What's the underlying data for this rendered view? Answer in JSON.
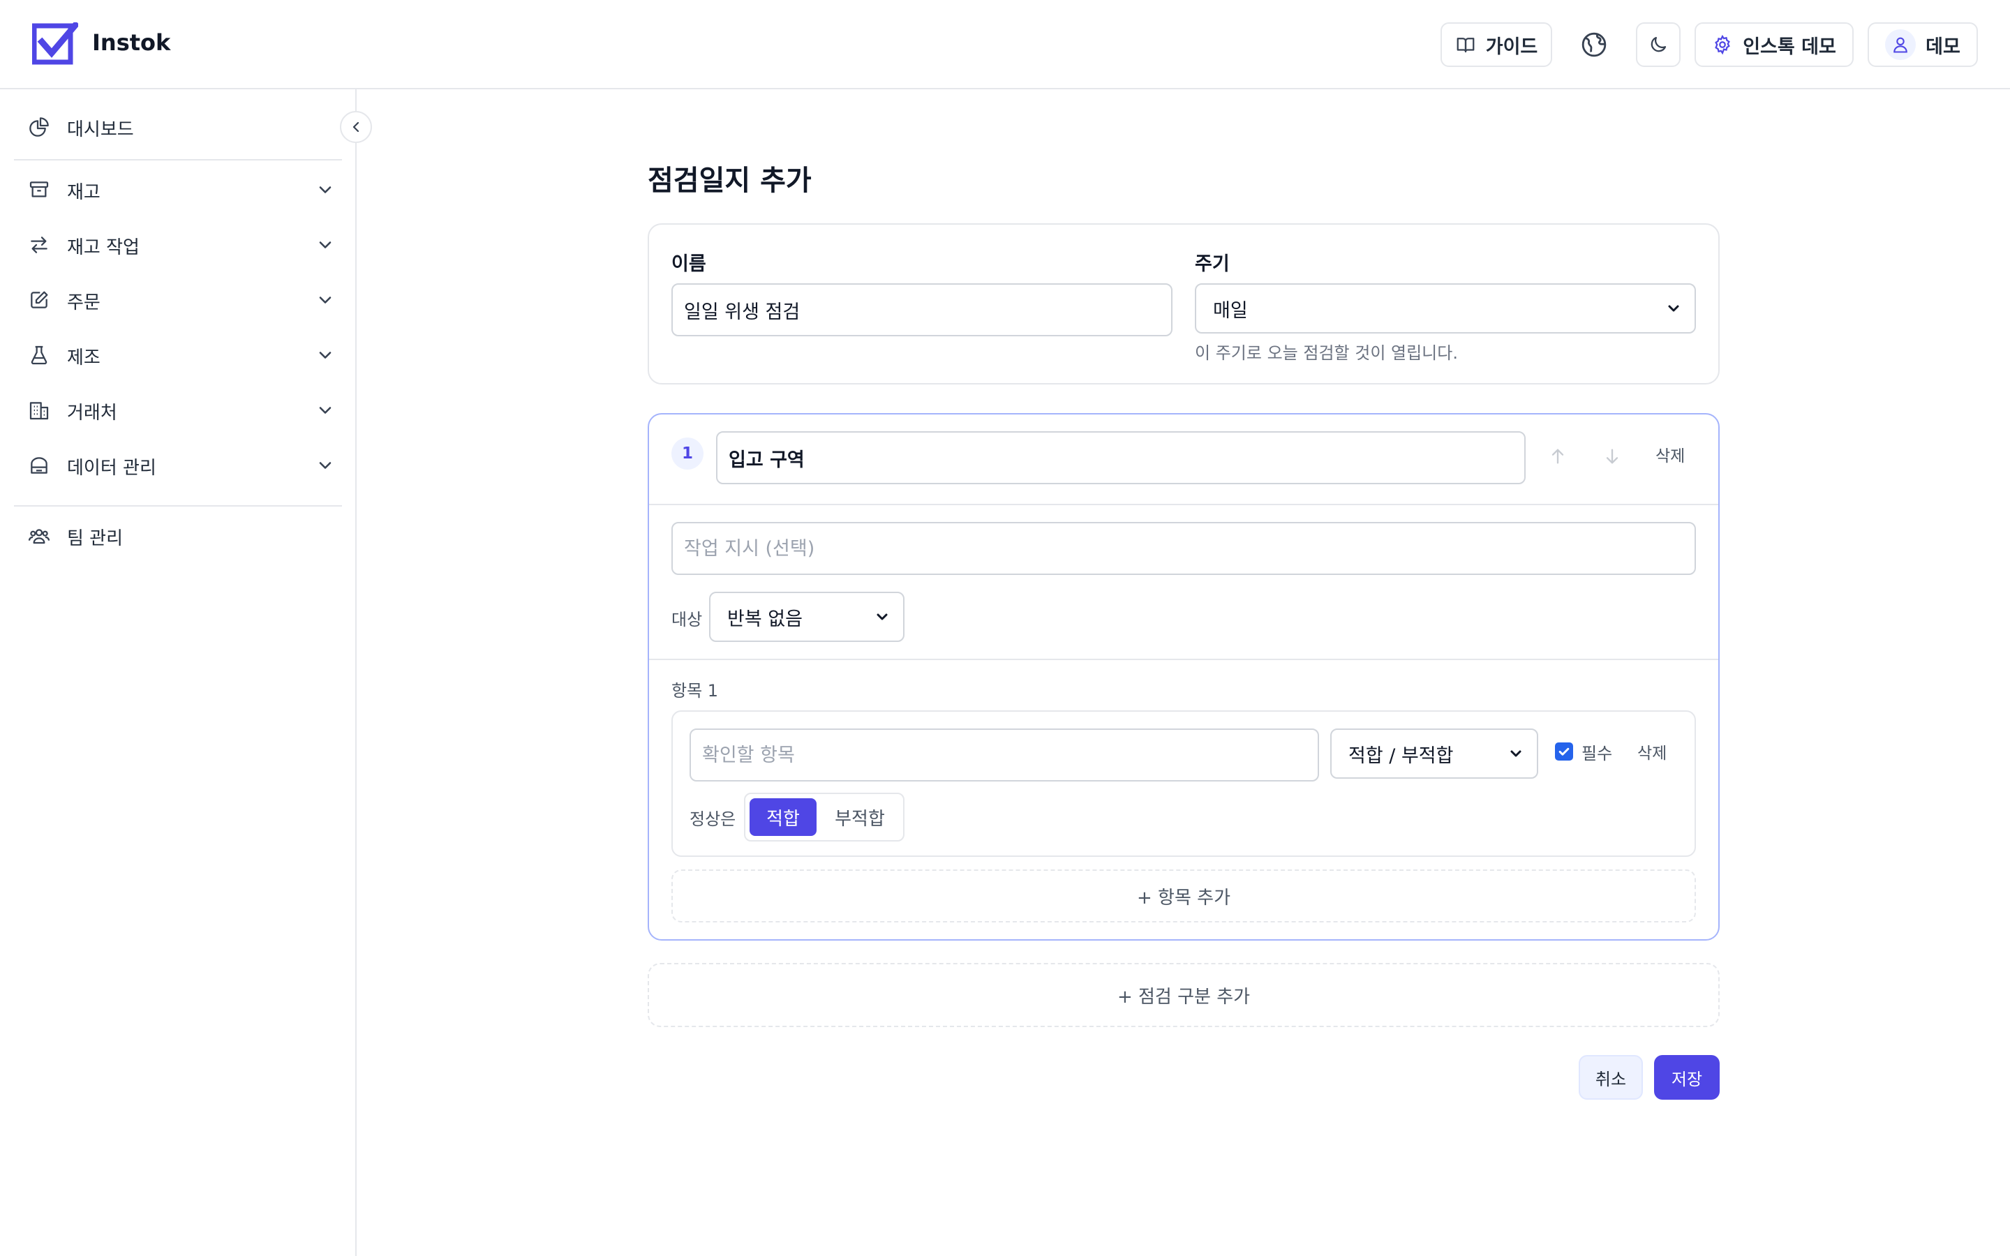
{
  "app": {
    "brand": "Instok"
  },
  "header": {
    "guide_label": "가이드",
    "workspace_label": "인스톡 데모",
    "user_label": "데모"
  },
  "sidebar": {
    "items": [
      {
        "label": "대시보드",
        "icon": "chart-pie-icon"
      },
      {
        "label": "재고",
        "icon": "archive-box-icon"
      },
      {
        "label": "재고 작업",
        "icon": "arrows-swap-icon"
      },
      {
        "label": "주문",
        "icon": "edit-document-icon"
      },
      {
        "label": "제조",
        "icon": "beaker-icon"
      },
      {
        "label": "거래처",
        "icon": "building-icon"
      },
      {
        "label": "데이터 관리",
        "icon": "database-icon"
      },
      {
        "label": "팀 관리",
        "icon": "users-icon"
      }
    ]
  },
  "page": {
    "title": "점검일지 추가"
  },
  "form": {
    "name_label": "이름",
    "name_value": "일일 위생 점검",
    "cycle_label": "주기",
    "cycle_value": "매일",
    "cycle_hint": "이 주기로 오늘 점검할 것이 열립니다."
  },
  "section": {
    "number": "1",
    "title_value": "입고 구역",
    "delete_label": "삭제",
    "instruction_placeholder": "작업 지시 (선택)",
    "target_label": "대상",
    "target_value": "반복 없음",
    "item_heading": "항목 1",
    "item": {
      "placeholder": "확인할 항목",
      "type_value": "적합 / 부적합",
      "required_label": "필수",
      "delete_label": "삭제",
      "normal_label": "정상은",
      "options": [
        "적합",
        "부적합"
      ],
      "selected_option": "적합"
    },
    "add_item_label": "+ 항목 추가"
  },
  "add_section_label": "+ 점검 구분 추가",
  "actions": {
    "cancel_label": "취소",
    "save_label": "저장"
  },
  "colors": {
    "accent": "#4f46e5",
    "accent_light": "#eef2ff",
    "border": "#e5e7eb",
    "section_border": "#a5b4fc",
    "checkbox": "#2563eb"
  }
}
